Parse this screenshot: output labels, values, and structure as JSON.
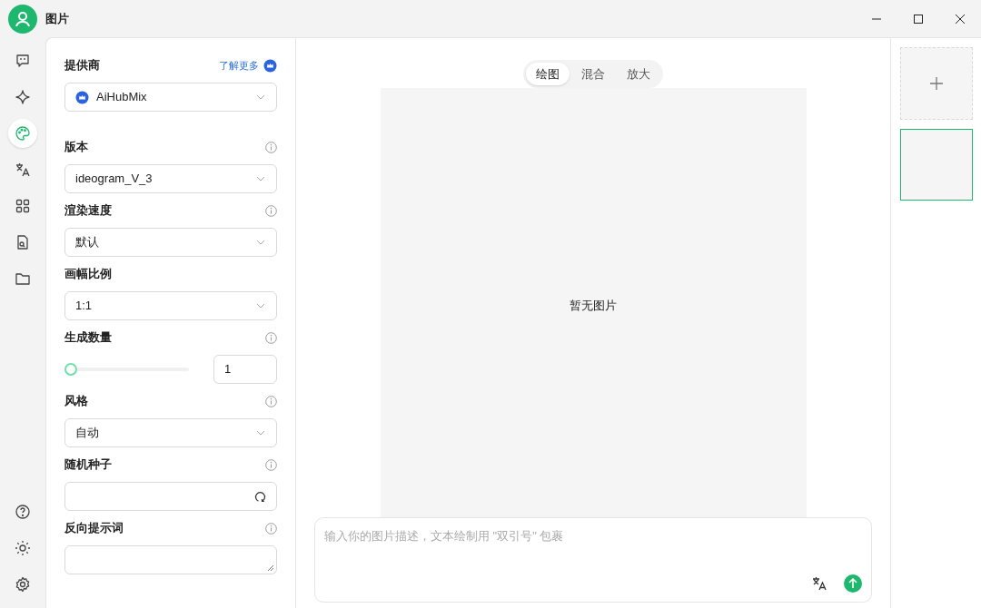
{
  "window": {
    "title": "图片"
  },
  "nav": [
    {
      "selected": false
    },
    {
      "selected": false
    },
    {
      "selected": true
    },
    {
      "selected": false
    },
    {
      "selected": false
    },
    {
      "selected": false
    },
    {
      "selected": false
    }
  ],
  "settings": [
    {
      "kind": "select",
      "label": "提供商",
      "link": "了解更多",
      "value": "AiHubMix",
      "provider_icon": true,
      "info": false
    },
    {
      "kind": "select",
      "label": "版本",
      "value": "ideogram_V_3",
      "info": true
    },
    {
      "kind": "select",
      "label": "渲染速度",
      "value": "默认",
      "info": true
    },
    {
      "kind": "select",
      "label": "画幅比例",
      "value": "1:1",
      "info": false
    },
    {
      "kind": "slider",
      "label": "生成数量",
      "level": 0,
      "value": "1",
      "info": true
    },
    {
      "kind": "select",
      "label": "风格",
      "value": "自动",
      "info": true
    },
    {
      "kind": "seed",
      "label": "随机种子",
      "info": true
    },
    {
      "kind": "textarea",
      "label": "反向提示词",
      "info": true
    }
  ],
  "tabs": [
    {
      "label": "绘图",
      "selected": true
    },
    {
      "label": "混合",
      "selected": false
    },
    {
      "label": "放大",
      "selected": false
    }
  ],
  "canvas": {
    "empty_text": "暂无图片"
  },
  "prompt": {
    "placeholder": "输入你的图片描述，文本绘制用 \"双引号\" 包裹"
  },
  "history": [
    {
      "selected": true
    }
  ]
}
